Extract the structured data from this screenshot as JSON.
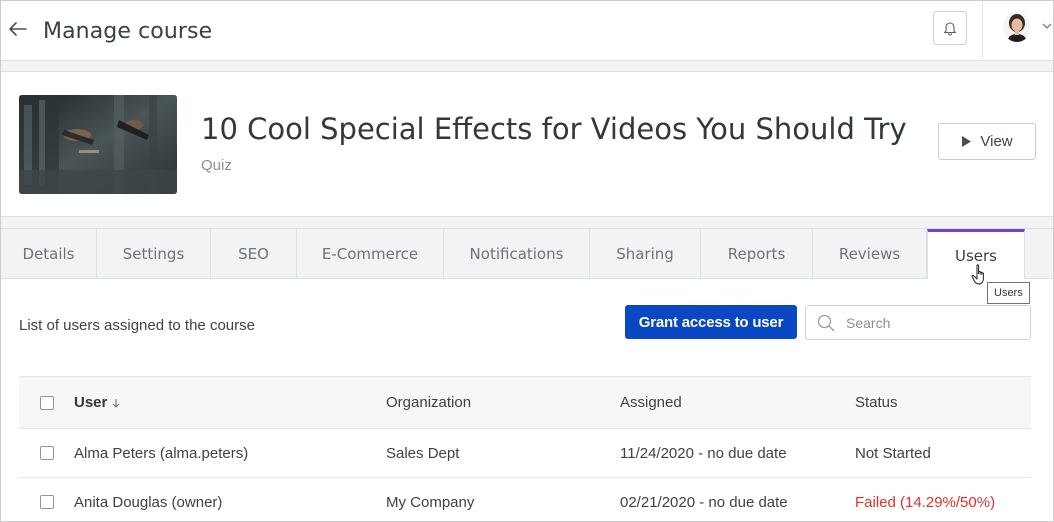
{
  "header": {
    "title": "Manage course"
  },
  "course": {
    "title": "10 Cool Special Effects for Videos You Should Try",
    "type": "Quiz",
    "view_label": "View"
  },
  "tabs": [
    {
      "label": "Details",
      "active": false
    },
    {
      "label": "Settings",
      "active": false
    },
    {
      "label": "SEO",
      "active": false
    },
    {
      "label": "E-Commerce",
      "active": false
    },
    {
      "label": "Notifications",
      "active": false
    },
    {
      "label": "Sharing",
      "active": false
    },
    {
      "label": "Reports",
      "active": false
    },
    {
      "label": "Reviews",
      "active": false
    },
    {
      "label": "Users",
      "active": true
    }
  ],
  "tooltip": "Users",
  "users_panel": {
    "caption": "List of users assigned to the course",
    "grant_label": "Grant access to user",
    "search_placeholder": "Search",
    "columns": {
      "user": "User",
      "organization": "Organization",
      "assigned": "Assigned",
      "status": "Status"
    },
    "rows": [
      {
        "user": "Alma Peters (alma.peters)",
        "organization": "Sales Dept",
        "assigned": "11/24/2020 - no due date",
        "status": "Not Started"
      },
      {
        "user": "Anita Douglas (owner)",
        "organization": "My Company",
        "assigned": "02/21/2020 - no due date",
        "status": "Failed (14.29%/50%)"
      }
    ]
  },
  "colors": {
    "accent_tab": "#7b3fc1",
    "primary_button": "#0a47c2",
    "failed_status": "#e0312f"
  },
  "icons": {
    "back": "arrow-left-icon",
    "bell": "bell-icon",
    "caret": "chevron-down-icon",
    "play": "play-icon",
    "search": "search-icon",
    "sort": "arrow-down-icon"
  }
}
